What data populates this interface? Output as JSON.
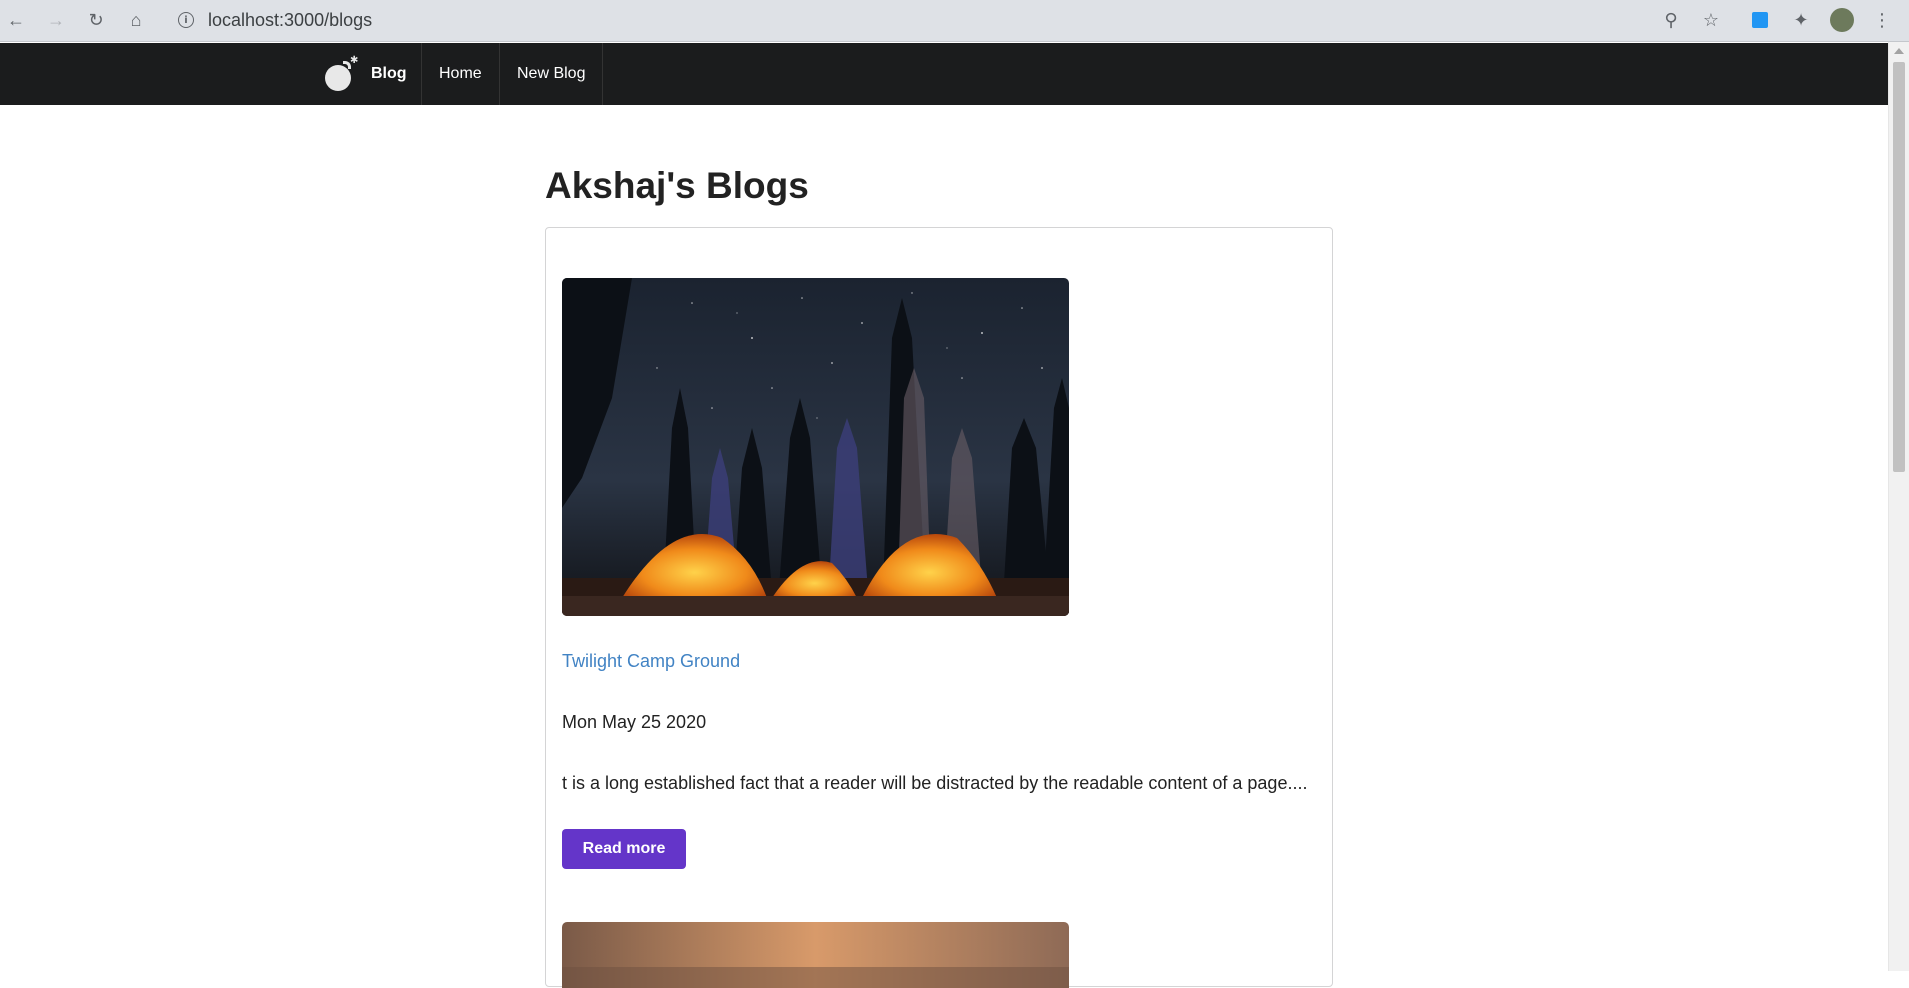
{
  "browser": {
    "url": "localhost:3000/blogs"
  },
  "navbar": {
    "brand_label": "Blog",
    "items": [
      {
        "label": "Home"
      },
      {
        "label": "New Blog"
      }
    ]
  },
  "page": {
    "title": "Akshaj's Blogs"
  },
  "blogs": [
    {
      "title": "Twilight Camp Ground",
      "date": "Mon May 25 2020",
      "excerpt": "t is a long established fact that a reader will be distracted by the readable content of a page....",
      "button_label": "Read more",
      "image": "night-camping-tents-photo"
    },
    {
      "image": "sunset-photo"
    }
  ],
  "colors": {
    "navbar_bg": "#1b1c1d",
    "link": "#4183c4",
    "button": "#6435c9"
  }
}
